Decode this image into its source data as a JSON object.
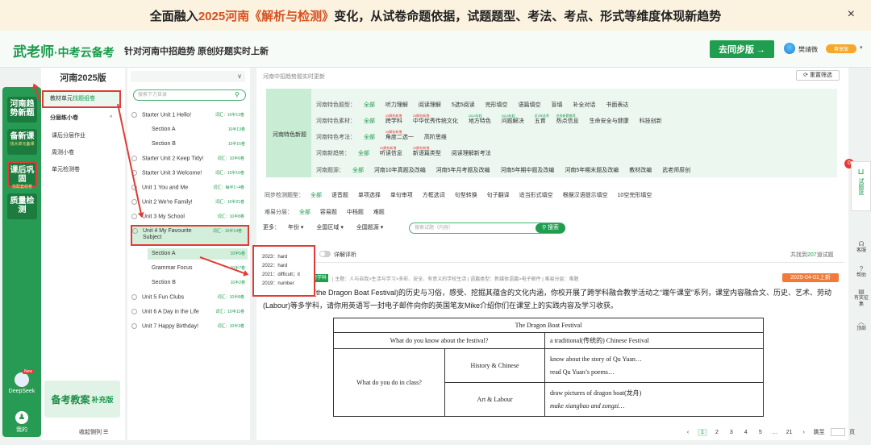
{
  "banner": {
    "prefix": "全面融入",
    "highlight": "2025河南《解析与检测》",
    "suffix": "变化，从试卷命题依据，试题题型、考法、考点、形式等维度体现新趋势",
    "close": "×"
  },
  "header": {
    "logo": "武老师",
    "logo_sub": "·中考云备考",
    "slogan": "针对河南中招趋势 原创好题实时上新",
    "sync_button": "去同步版 →",
    "user_name": "樊靖微",
    "vip": "尊享版",
    "chevron": "▾"
  },
  "leftbar": {
    "items": [
      {
        "label": "河南趋势新题",
        "sub": ""
      },
      {
        "label": "备新课",
        "sub": "找大单元备课"
      },
      {
        "label": "课后巩固",
        "sub": "找配套组卷"
      },
      {
        "label": "质量检测",
        "sub": ""
      }
    ],
    "ai_label": "DeepSeek",
    "ai_new": "New",
    "me_label": "我的",
    "me_icon": "♟"
  },
  "col2": {
    "title": "河南2025版",
    "tab_prefix": "教材单元",
    "tab_green": "找题组卷",
    "group": "分层练小卷",
    "expand": "^",
    "items": [
      "课后分层作业",
      "周测小卷",
      "单元检测卷"
    ],
    "promo": "备考教案",
    "promo_sub": "补充版",
    "collapse": "收起侧列 ☰"
  },
  "col3": {
    "dropdown": "∨",
    "search_placeholder": "搜索下方目录",
    "search_icon": "⚲",
    "units": [
      {
        "label": "Starter Unit 1 Hello!",
        "count": "词汇：10半13卷",
        "sections": [
          {
            "label": "Section A",
            "count": "10半13卷"
          },
          {
            "label": "Section B",
            "count": "10半15卷"
          }
        ]
      },
      {
        "label": "Starter Unit 2 Keep Tidy!",
        "count": "词汇：10半6卷",
        "sections": []
      },
      {
        "label": "Starter Unit 3 Welcome!",
        "count": "词汇：10半10卷",
        "sections": []
      },
      {
        "label": "Unit 1 You and Me",
        "count": "词汇：每半1~4卷",
        "sections": []
      },
      {
        "label": "Unit 2 We're Family!",
        "count": "词汇：10半21卷",
        "sections": []
      },
      {
        "label": "Unit 3 My School",
        "count": "词汇：10半8卷",
        "sections": []
      }
    ],
    "unit4": {
      "label": "Unit 4 My Favourite Subject",
      "count": "词汇：10半14卷",
      "sections": [
        {
          "label": "Section A",
          "count": "10半5卷"
        },
        {
          "label": "Grammar Focus",
          "count": "10半7卷"
        },
        {
          "label": "Section B",
          "count": "10半2卷"
        }
      ]
    },
    "units_after": [
      {
        "label": "Unit 5 Fun Clubs",
        "count": "词汇：10半8卷"
      },
      {
        "label": "Unit 6 A Day in the Life",
        "count": "词汇：10半11卷"
      },
      {
        "label": "Unit 7 Happy Birthday!",
        "count": "词汇：10半3卷"
      }
    ]
  },
  "main": {
    "crumb": "河南中招趋势题实时更新",
    "reset": "⟳ 重置筛选",
    "feature_label": "河南特色新题",
    "rows": [
      {
        "label": "河南特色题型：",
        "opts": [
          {
            "t": "全部"
          },
          {
            "t": "听力理解"
          },
          {
            "t": "阅读理解"
          },
          {
            "t": "5选5阅读"
          },
          {
            "t": "完形填空"
          },
          {
            "t": "语篇填空"
          },
          {
            "t": "盲填"
          },
          {
            "t": "补全对话"
          },
          {
            "t": "书面表达"
          }
        ]
      },
      {
        "label": "河南特色素材：",
        "opts": [
          {
            "t": "全部"
          },
          {
            "t": "跨学科",
            "n": "25解析新增"
          },
          {
            "t": "中华优秀传统文化",
            "n": "25解析新增"
          },
          {
            "t": "地方特色",
            "n": "2024年起"
          },
          {
            "t": "问题解决",
            "n": "2024年起"
          },
          {
            "t": "五育",
            "n": "近3年连考"
          },
          {
            "t": "热点信息",
            "n": "名校新题推荐"
          },
          {
            "t": "生命安全与健康"
          },
          {
            "t": "科技创新"
          }
        ]
      },
      {
        "label": "河南特色考法：",
        "opts": [
          {
            "t": "全部"
          },
          {
            "t": "角度二选一",
            "n": "25解析新增"
          },
          {
            "t": "高阶思维"
          }
        ]
      },
      {
        "label": "河南新趋势：",
        "opts": [
          {
            "t": "全部"
          },
          {
            "t": "听读信息",
            "n": "25解析新增"
          },
          {
            "t": "新语篇类型",
            "n": "25解析新增"
          },
          {
            "t": "阅读理解新考法"
          }
        ]
      },
      {
        "label": "河南题源：",
        "opts": [
          {
            "t": "全部"
          },
          {
            "t": "河南10年真题及改编"
          },
          {
            "t": "河南5年月考题及改编"
          },
          {
            "t": "河南5年期中题及改编"
          },
          {
            "t": "河南5年期末题及改编"
          },
          {
            "t": "教材改编"
          },
          {
            "t": "武老师原创"
          }
        ]
      }
    ],
    "sync_row": {
      "label": "同步检测题型：",
      "opts": [
        "全部",
        "语音题",
        "单项选择",
        "单句审项",
        "方框选词",
        "句型转换",
        "句子翻译",
        "适当形式填空",
        "根据汉语提示填空",
        "10空完形填空"
      ]
    },
    "diff_row": {
      "label": "难易分层：",
      "opts": [
        "全部",
        "容易题",
        "中档题",
        "难题"
      ]
    },
    "filter": {
      "label": "更多：",
      "year": "年份 ▾",
      "region": "全国区域 ▾",
      "type": "全国题源 ▾"
    },
    "search_placeholder": "搜索试题（内容）",
    "search_button": "⚲ 搜索",
    "parse_label": "详解评析",
    "found": {
      "pre": "共找到",
      "num": "207",
      "suf": "道试题"
    },
    "popup": [
      "2023：hard",
      "2022：hard",
      "2021：difficult；it",
      "2019：number"
    ],
    "question": {
      "tag": "跨学科",
      "meta": "| 主题：人与自我>生活与学习>多彩、安全、有意义的学校生活 | 语篇类型：新媒体语篇>电子邮件 | 难易分层：难题",
      "date": "2025-04-01上新",
      "text": "好地了解端午节(the Dragon Boat Festival)的历史与习俗，感受、挖掘其蕴含的文化内涵，你校开展了跨学科融合教学活动之“端午课堂”系列，课堂内容融合文、历史、艺术、劳动(Labour)等多学科，请你用英语写一封电子邮件向你的英国笔友Mike介绍你们在课堂上的实践内容及学习收获。"
    },
    "table": {
      "title": "The Dragon Boat Festival",
      "q1": "What do you know about the festival?",
      "a1": "a traditional(传统的) Chinese Festival",
      "q2": "What do you do in class?",
      "hist": "History & Chinese",
      "hist1": "know about the story of Qu Yuan…",
      "hist2": "read Qu Yuan’s poems…",
      "art": "Art & Labour",
      "art1": "draw pictures of dragon boat(龙舟)",
      "art2": "make xiangbao and zongzi…"
    },
    "pager": [
      "‹",
      "1",
      "2",
      "3",
      "4",
      "5",
      "…",
      "21",
      "›",
      "跳至",
      "页"
    ]
  },
  "side": {
    "badge": "0",
    "basket": "试题篮",
    "tools": [
      "客服",
      "帮助",
      "有奖征集",
      "顶部"
    ]
  }
}
